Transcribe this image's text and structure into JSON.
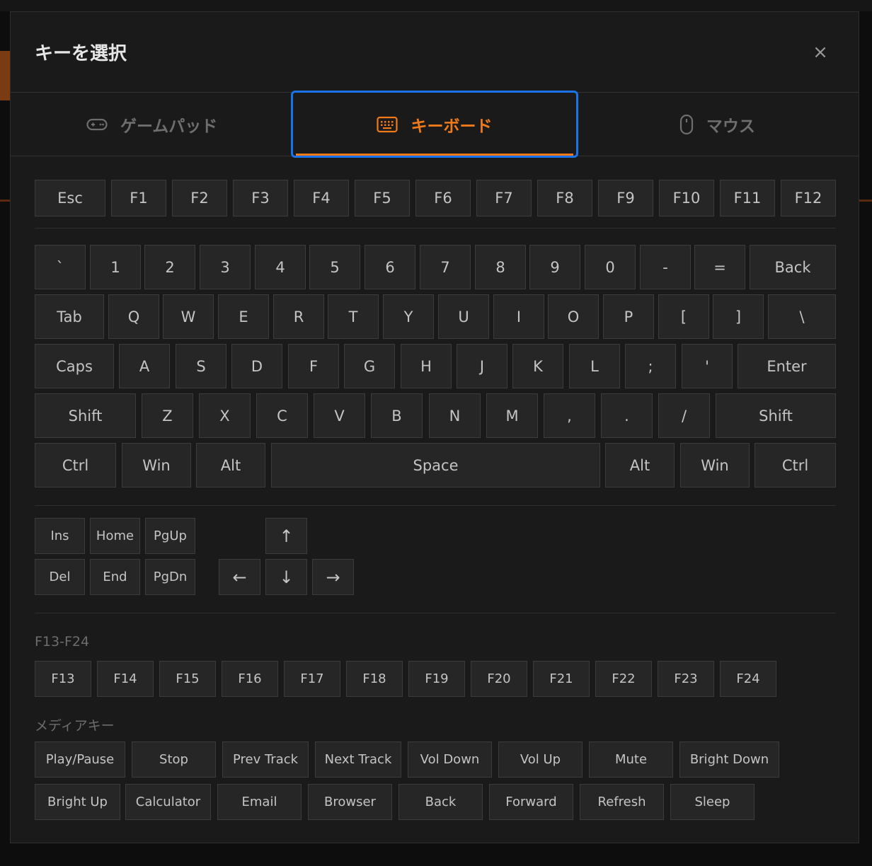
{
  "modal": {
    "title": "キーを選択",
    "close_symbol": "×"
  },
  "tabs": [
    {
      "label": "ゲームパッド",
      "icon": "gamepad-icon",
      "active": false
    },
    {
      "label": "キーボード",
      "icon": "keyboard-icon",
      "active": true
    },
    {
      "label": "マウス",
      "icon": "mouse-icon",
      "active": false
    }
  ],
  "function_row": [
    "Esc",
    "F1",
    "F2",
    "F3",
    "F4",
    "F5",
    "F6",
    "F7",
    "F8",
    "F9",
    "F10",
    "F11",
    "F12"
  ],
  "main_rows": [
    [
      "`",
      "1",
      "2",
      "3",
      "4",
      "5",
      "6",
      "7",
      "8",
      "9",
      "0",
      "-",
      "=",
      "Back"
    ],
    [
      "Tab",
      "Q",
      "W",
      "E",
      "R",
      "T",
      "Y",
      "U",
      "I",
      "O",
      "P",
      "[",
      "]",
      "\\"
    ],
    [
      "Caps",
      "A",
      "S",
      "D",
      "F",
      "G",
      "H",
      "J",
      "K",
      "L",
      ";",
      "'",
      "Enter"
    ],
    [
      "Shift",
      "Z",
      "X",
      "C",
      "V",
      "B",
      "N",
      "M",
      ",",
      ".",
      "/",
      "Shift"
    ],
    [
      "Ctrl",
      "Win",
      "Alt",
      "Space",
      "Alt",
      "Win",
      "Ctrl"
    ]
  ],
  "nav_cluster": {
    "top": [
      "Ins",
      "Home",
      "PgUp"
    ],
    "bottom": [
      "Del",
      "End",
      "PgDn"
    ]
  },
  "arrows": {
    "up": "↑",
    "left": "←",
    "down": "↓",
    "right": "→"
  },
  "f13_section": {
    "label": "F13-F24",
    "keys": [
      "F13",
      "F14",
      "F15",
      "F16",
      "F17",
      "F18",
      "F19",
      "F20",
      "F21",
      "F22",
      "F23",
      "F24"
    ]
  },
  "media_section": {
    "label": "メディアキー",
    "row1": [
      "Play/Pause",
      "Stop",
      "Prev Track",
      "Next Track",
      "Vol Down",
      "Vol Up",
      "Mute",
      "Bright Down"
    ],
    "row2": [
      "Bright Up",
      "Calculator",
      "Email",
      "Browser",
      "Back",
      "Forward",
      "Refresh",
      "Sleep"
    ]
  },
  "colors": {
    "accent": "#f07a1a",
    "focus": "#1a73e8"
  }
}
